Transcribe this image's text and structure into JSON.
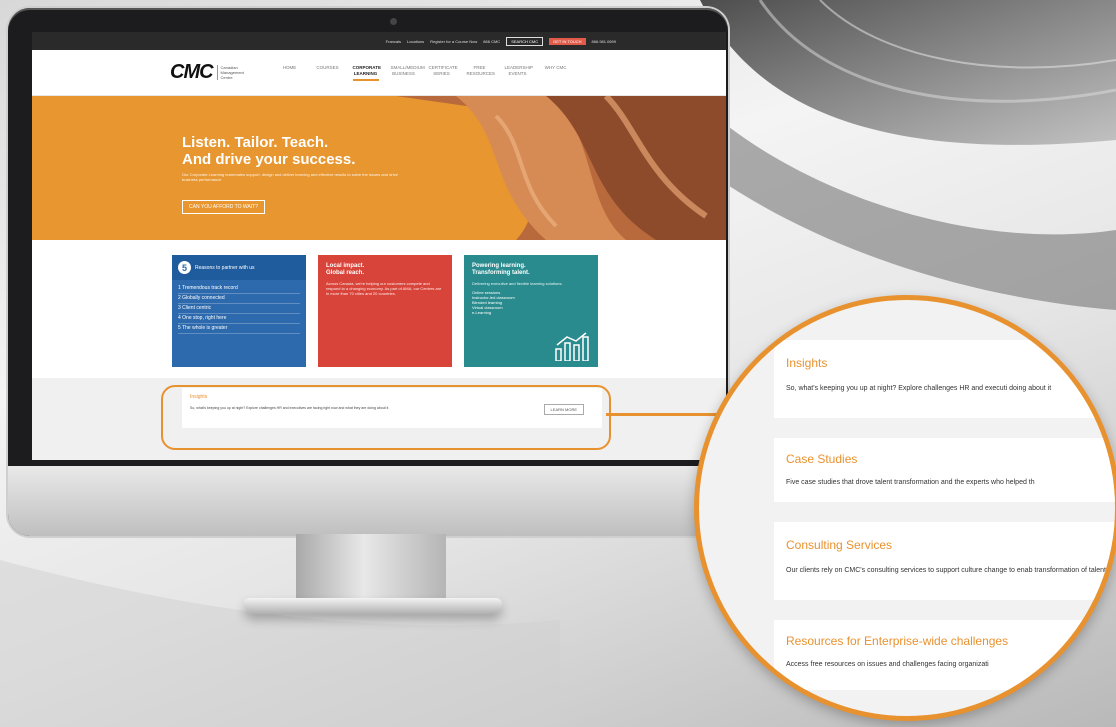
{
  "site": {
    "topbar": {
      "links": [
        "Francais",
        "Locations",
        "Register for a Course Now",
        "866 CMC",
        "SEARCH CMC",
        "GET IN TOUCH",
        "866.981.0699"
      ]
    },
    "logo": {
      "mark": "CMC",
      "sub": "Canadian Management Centre"
    },
    "nav": [
      "HOME",
      "COURSES",
      "CORPORATE LEARNING",
      "SMALL/MEDIUM BUSINESS",
      "CERTIFICATE SERIES",
      "FREE RESOURCES",
      "LEADERSHIP EVENTS",
      "WHY CMC"
    ],
    "active_nav_index": 2,
    "hero": {
      "title_line1": "Listen. Tailor. Teach.",
      "title_line2": "And drive your success.",
      "sub": "Our Corporate Learning teammates support, design and deliver learning and effective results to solve the issues and drive business performance",
      "button": "CAN YOU AFFORD TO WAIT?"
    },
    "card_blue": {
      "number": "5",
      "head": "Reasons to partner with us",
      "items": [
        "1 Tremendous track record",
        "2 Globally connected",
        "3 Client centric",
        "4 One stop, right here",
        "5 The whole is greater"
      ]
    },
    "card_red": {
      "title1": "Local impact.",
      "title2": "Global reach.",
      "body": "Across Canada, we're helping our customers compete and respond to a changing economy. As part of AMA, our Centres are in more than 70 cities and 20 countries."
    },
    "card_teal": {
      "title1": "Powering learning.",
      "title2": "Transforming talent.",
      "body": "Delivering executive and flexible learning solutions:",
      "list": [
        "Online sessions",
        "Instructor-led classroom",
        "Blended learning",
        "Virtual classroom",
        "e-Learning"
      ]
    },
    "insights": {
      "title": "Insights",
      "text": "So, what's keeping you up at night? Explore challenges HR and executives are facing right now and what they are doing about it",
      "button": "LEARN MORE"
    }
  },
  "magnifier": {
    "items": [
      {
        "title": "Insights",
        "desc": "So, what's keeping you up at night?  Explore challenges HR and executi doing about it"
      },
      {
        "title": "Case Studies",
        "desc": "Five case studies that drove talent transformation and the experts who helped th"
      },
      {
        "title": "Consulting Services",
        "desc": "Our clients rely on CMC's consulting services to support culture change to enab transformation of talent"
      },
      {
        "title": "Resources for Enterprise-wide challenges",
        "desc": "Access free resources on issues and challenges facing organizati"
      }
    ]
  },
  "colors": {
    "accent": "#e8922f",
    "blue": "#2c69ad",
    "red": "#d9443a",
    "teal": "#2a8b8e"
  }
}
